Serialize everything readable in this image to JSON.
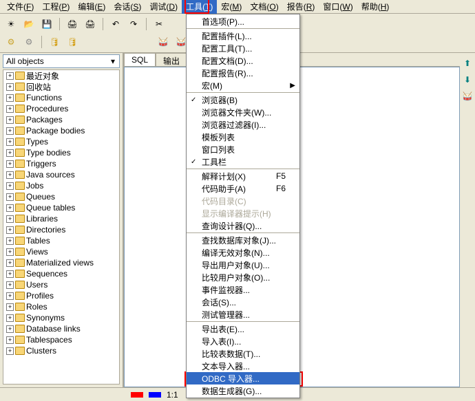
{
  "menubar": {
    "items": [
      {
        "label": "文件",
        "hotkey": "F"
      },
      {
        "label": "工程",
        "hotkey": "P"
      },
      {
        "label": "编辑",
        "hotkey": "E"
      },
      {
        "label": "会话",
        "hotkey": "S"
      },
      {
        "label": "调试",
        "hotkey": "D"
      },
      {
        "label": "工具",
        "hotkey": "T",
        "active": true
      },
      {
        "label": "宏",
        "hotkey": "M"
      },
      {
        "label": "文档",
        "hotkey": "O"
      },
      {
        "label": "报告",
        "hotkey": "R"
      },
      {
        "label": "窗口",
        "hotkey": "W"
      },
      {
        "label": "帮助",
        "hotkey": "H"
      }
    ]
  },
  "filter": {
    "value": "All objects"
  },
  "tree": {
    "items": [
      "最近对象",
      "回收站",
      "Functions",
      "Procedures",
      "Packages",
      "Package bodies",
      "Types",
      "Type bodies",
      "Triggers",
      "Java sources",
      "Jobs",
      "Queues",
      "Queue tables",
      "Libraries",
      "Directories",
      "Tables",
      "Views",
      "Materialized views",
      "Sequences",
      "Users",
      "Profiles",
      "Roles",
      "Synonyms",
      "Database links",
      "Tablespaces",
      "Clusters"
    ]
  },
  "tabs": {
    "left": "SQL",
    "right": "输出"
  },
  "tools_menu": {
    "groups": [
      [
        {
          "label": "首选项(P)..."
        }
      ],
      [
        {
          "label": "配置插件(L)..."
        },
        {
          "label": "配置工具(T)..."
        },
        {
          "label": "配置文档(D)..."
        },
        {
          "label": "配置报告(R)..."
        },
        {
          "label": "宏(M)",
          "arrow": true
        }
      ],
      [
        {
          "label": "浏览器(B)",
          "checked": true
        },
        {
          "label": "浏览器文件夹(W)..."
        },
        {
          "label": "浏览器过滤器(I)..."
        },
        {
          "label": "模板列表"
        },
        {
          "label": "窗口列表"
        },
        {
          "label": "工具栏",
          "checked": true
        }
      ],
      [
        {
          "label": "解释计划(X)",
          "shortcut": "F5"
        },
        {
          "label": "代码助手(A)",
          "shortcut": "F6"
        },
        {
          "label": "代码目录(C)",
          "disabled": true
        },
        {
          "label": "显示编译器提示(H)",
          "disabled": true
        },
        {
          "label": "查询设计器(Q)..."
        }
      ],
      [
        {
          "label": "查找数据库对象(J)..."
        },
        {
          "label": "编译无效对象(N)..."
        },
        {
          "label": "导出用户对象(U)..."
        },
        {
          "label": "比较用户对象(O)..."
        },
        {
          "label": "事件监视器..."
        },
        {
          "label": "会话(S)..."
        },
        {
          "label": "测试管理器..."
        }
      ],
      [
        {
          "label": "导出表(E)..."
        },
        {
          "label": "导入表(I)..."
        },
        {
          "label": "比较表数据(T)..."
        },
        {
          "label": "文本导入器..."
        },
        {
          "label": "ODBC 导入器...",
          "highlighted": true
        },
        {
          "label": "数据生成器(G)..."
        }
      ]
    ]
  },
  "status": {
    "pos": "1:1"
  }
}
